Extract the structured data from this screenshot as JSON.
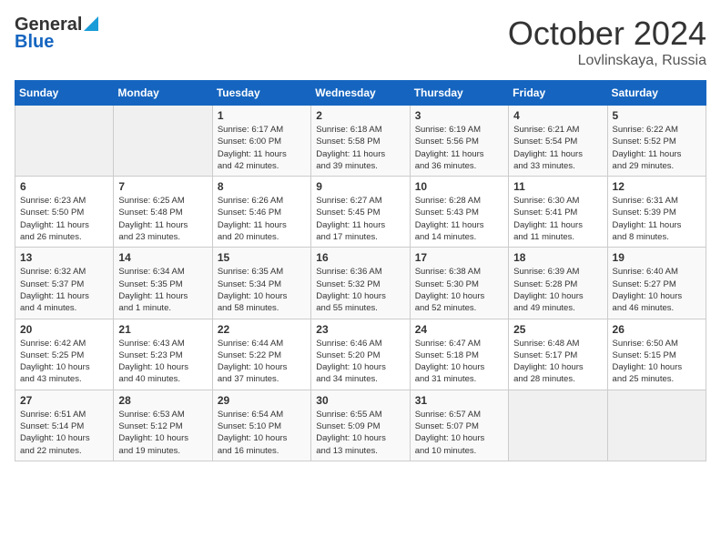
{
  "header": {
    "logo_general": "General",
    "logo_blue": "Blue",
    "month_title": "October 2024",
    "location": "Lovlinskaya, Russia"
  },
  "weekdays": [
    "Sunday",
    "Monday",
    "Tuesday",
    "Wednesday",
    "Thursday",
    "Friday",
    "Saturday"
  ],
  "weeks": [
    [
      {
        "day": "",
        "info": ""
      },
      {
        "day": "",
        "info": ""
      },
      {
        "day": "1",
        "info": "Sunrise: 6:17 AM\nSunset: 6:00 PM\nDaylight: 11 hours\nand 42 minutes."
      },
      {
        "day": "2",
        "info": "Sunrise: 6:18 AM\nSunset: 5:58 PM\nDaylight: 11 hours\nand 39 minutes."
      },
      {
        "day": "3",
        "info": "Sunrise: 6:19 AM\nSunset: 5:56 PM\nDaylight: 11 hours\nand 36 minutes."
      },
      {
        "day": "4",
        "info": "Sunrise: 6:21 AM\nSunset: 5:54 PM\nDaylight: 11 hours\nand 33 minutes."
      },
      {
        "day": "5",
        "info": "Sunrise: 6:22 AM\nSunset: 5:52 PM\nDaylight: 11 hours\nand 29 minutes."
      }
    ],
    [
      {
        "day": "6",
        "info": "Sunrise: 6:23 AM\nSunset: 5:50 PM\nDaylight: 11 hours\nand 26 minutes."
      },
      {
        "day": "7",
        "info": "Sunrise: 6:25 AM\nSunset: 5:48 PM\nDaylight: 11 hours\nand 23 minutes."
      },
      {
        "day": "8",
        "info": "Sunrise: 6:26 AM\nSunset: 5:46 PM\nDaylight: 11 hours\nand 20 minutes."
      },
      {
        "day": "9",
        "info": "Sunrise: 6:27 AM\nSunset: 5:45 PM\nDaylight: 11 hours\nand 17 minutes."
      },
      {
        "day": "10",
        "info": "Sunrise: 6:28 AM\nSunset: 5:43 PM\nDaylight: 11 hours\nand 14 minutes."
      },
      {
        "day": "11",
        "info": "Sunrise: 6:30 AM\nSunset: 5:41 PM\nDaylight: 11 hours\nand 11 minutes."
      },
      {
        "day": "12",
        "info": "Sunrise: 6:31 AM\nSunset: 5:39 PM\nDaylight: 11 hours\nand 8 minutes."
      }
    ],
    [
      {
        "day": "13",
        "info": "Sunrise: 6:32 AM\nSunset: 5:37 PM\nDaylight: 11 hours\nand 4 minutes."
      },
      {
        "day": "14",
        "info": "Sunrise: 6:34 AM\nSunset: 5:35 PM\nDaylight: 11 hours\nand 1 minute."
      },
      {
        "day": "15",
        "info": "Sunrise: 6:35 AM\nSunset: 5:34 PM\nDaylight: 10 hours\nand 58 minutes."
      },
      {
        "day": "16",
        "info": "Sunrise: 6:36 AM\nSunset: 5:32 PM\nDaylight: 10 hours\nand 55 minutes."
      },
      {
        "day": "17",
        "info": "Sunrise: 6:38 AM\nSunset: 5:30 PM\nDaylight: 10 hours\nand 52 minutes."
      },
      {
        "day": "18",
        "info": "Sunrise: 6:39 AM\nSunset: 5:28 PM\nDaylight: 10 hours\nand 49 minutes."
      },
      {
        "day": "19",
        "info": "Sunrise: 6:40 AM\nSunset: 5:27 PM\nDaylight: 10 hours\nand 46 minutes."
      }
    ],
    [
      {
        "day": "20",
        "info": "Sunrise: 6:42 AM\nSunset: 5:25 PM\nDaylight: 10 hours\nand 43 minutes."
      },
      {
        "day": "21",
        "info": "Sunrise: 6:43 AM\nSunset: 5:23 PM\nDaylight: 10 hours\nand 40 minutes."
      },
      {
        "day": "22",
        "info": "Sunrise: 6:44 AM\nSunset: 5:22 PM\nDaylight: 10 hours\nand 37 minutes."
      },
      {
        "day": "23",
        "info": "Sunrise: 6:46 AM\nSunset: 5:20 PM\nDaylight: 10 hours\nand 34 minutes."
      },
      {
        "day": "24",
        "info": "Sunrise: 6:47 AM\nSunset: 5:18 PM\nDaylight: 10 hours\nand 31 minutes."
      },
      {
        "day": "25",
        "info": "Sunrise: 6:48 AM\nSunset: 5:17 PM\nDaylight: 10 hours\nand 28 minutes."
      },
      {
        "day": "26",
        "info": "Sunrise: 6:50 AM\nSunset: 5:15 PM\nDaylight: 10 hours\nand 25 minutes."
      }
    ],
    [
      {
        "day": "27",
        "info": "Sunrise: 6:51 AM\nSunset: 5:14 PM\nDaylight: 10 hours\nand 22 minutes."
      },
      {
        "day": "28",
        "info": "Sunrise: 6:53 AM\nSunset: 5:12 PM\nDaylight: 10 hours\nand 19 minutes."
      },
      {
        "day": "29",
        "info": "Sunrise: 6:54 AM\nSunset: 5:10 PM\nDaylight: 10 hours\nand 16 minutes."
      },
      {
        "day": "30",
        "info": "Sunrise: 6:55 AM\nSunset: 5:09 PM\nDaylight: 10 hours\nand 13 minutes."
      },
      {
        "day": "31",
        "info": "Sunrise: 6:57 AM\nSunset: 5:07 PM\nDaylight: 10 hours\nand 10 minutes."
      },
      {
        "day": "",
        "info": ""
      },
      {
        "day": "",
        "info": ""
      }
    ]
  ]
}
